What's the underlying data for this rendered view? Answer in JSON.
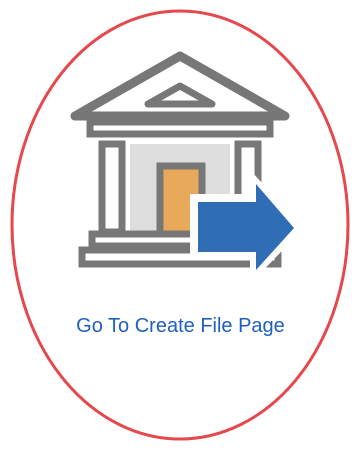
{
  "link": {
    "label": "Go To Create File Page"
  },
  "icons": {
    "building": "bank-building-icon",
    "arrow": "arrow-right-icon"
  },
  "colors": {
    "oval_border": "#e5484d",
    "building_stroke": "#777777",
    "door": "#e8a95a",
    "arrow": "#2f6db5",
    "link_text": "#1f5fbf"
  }
}
